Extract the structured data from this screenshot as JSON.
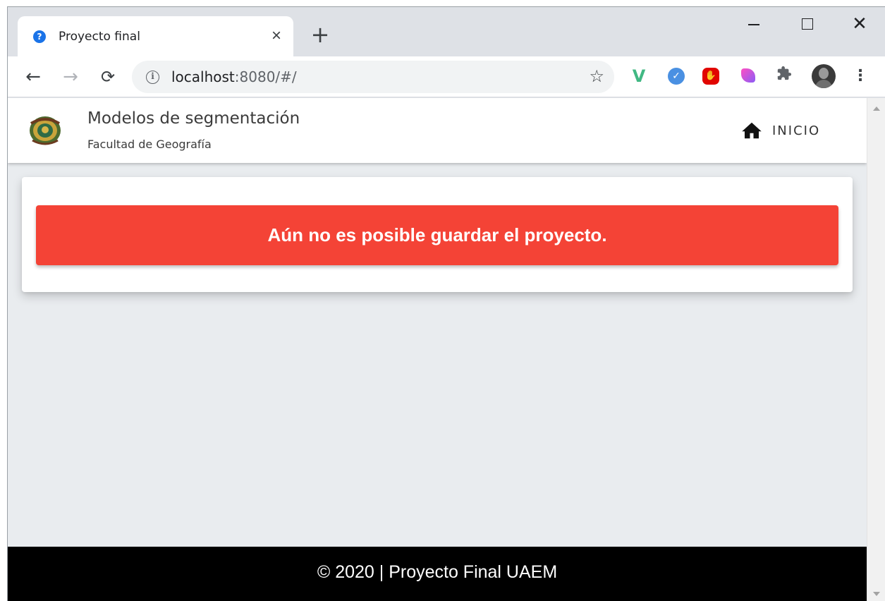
{
  "browser": {
    "tab": {
      "title": "Proyecto final",
      "favicon": "help-circle-icon",
      "close": "×"
    },
    "new_tab": "+",
    "window_controls": {
      "close": "✕"
    },
    "nav": {
      "back": "←",
      "forward": "→",
      "reload": "⟳"
    },
    "omnibox": {
      "info": "i",
      "host": "localhost",
      "rest": ":8080/#/",
      "star": "☆"
    },
    "extensions": [
      "vue-devtools-icon",
      "shield-extension-icon",
      "stop-extension-icon",
      "pen-extension-icon",
      "puzzle-icon"
    ],
    "menu": "⋮"
  },
  "app": {
    "title": "Modelos de segmentación",
    "subtitle": "Facultad de Geografía",
    "home_label": "INICIO"
  },
  "alert": {
    "message": "Aún no es posible guardar el proyecto.",
    "color": "#f44336"
  },
  "footer": {
    "text": "© 2020 | Proyecto Final UAEM"
  }
}
